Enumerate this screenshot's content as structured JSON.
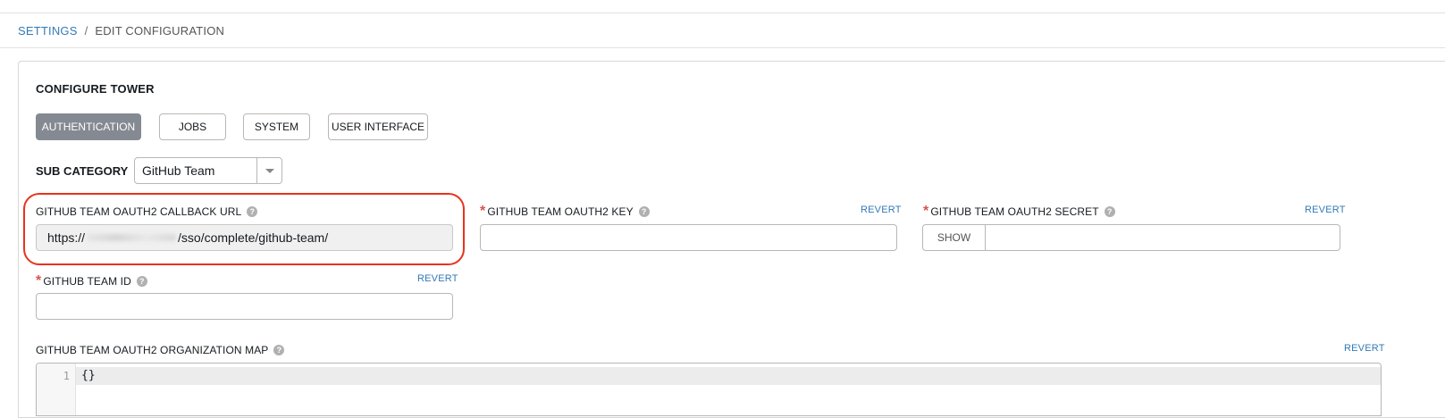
{
  "breadcrumb": {
    "settings": "SETTINGS",
    "separator": "/",
    "current": "EDIT CONFIGURATION"
  },
  "panel": {
    "title": "CONFIGURE TOWER"
  },
  "tabs": [
    {
      "label": "AUTHENTICATION",
      "active": true
    },
    {
      "label": "JOBS",
      "active": false
    },
    {
      "label": "SYSTEM",
      "active": false
    },
    {
      "label": "USER INTERFACE",
      "active": false
    }
  ],
  "sub_category": {
    "label": "SUB CATEGORY",
    "selected": "GitHub Team"
  },
  "fields": {
    "callback_url": {
      "label": "GITHUB TEAM OAUTH2 CALLBACK URL",
      "value_prefix": "https://",
      "value_suffix": "/sso/complete/github-team/"
    },
    "oauth2_key": {
      "label": "GITHUB TEAM OAUTH2 KEY",
      "required": "*",
      "revert": "REVERT",
      "value": ""
    },
    "oauth2_secret": {
      "label": "GITHUB TEAM OAUTH2 SECRET",
      "required": "*",
      "revert": "REVERT",
      "show_label": "SHOW"
    },
    "team_id": {
      "label": "GITHUB TEAM ID",
      "required": "*",
      "revert": "REVERT",
      "value": ""
    },
    "org_map": {
      "label": "GITHUB TEAM OAUTH2 ORGANIZATION MAP",
      "revert": "REVERT",
      "line_number": "1",
      "code": "{}"
    }
  },
  "icons": {
    "help": "help-circle-icon",
    "dropdown": "chevron-down-icon"
  },
  "colors": {
    "link": "#337ab7",
    "active_tab": "#848992",
    "required": "#d9534f",
    "highlight": "#e8331c"
  }
}
